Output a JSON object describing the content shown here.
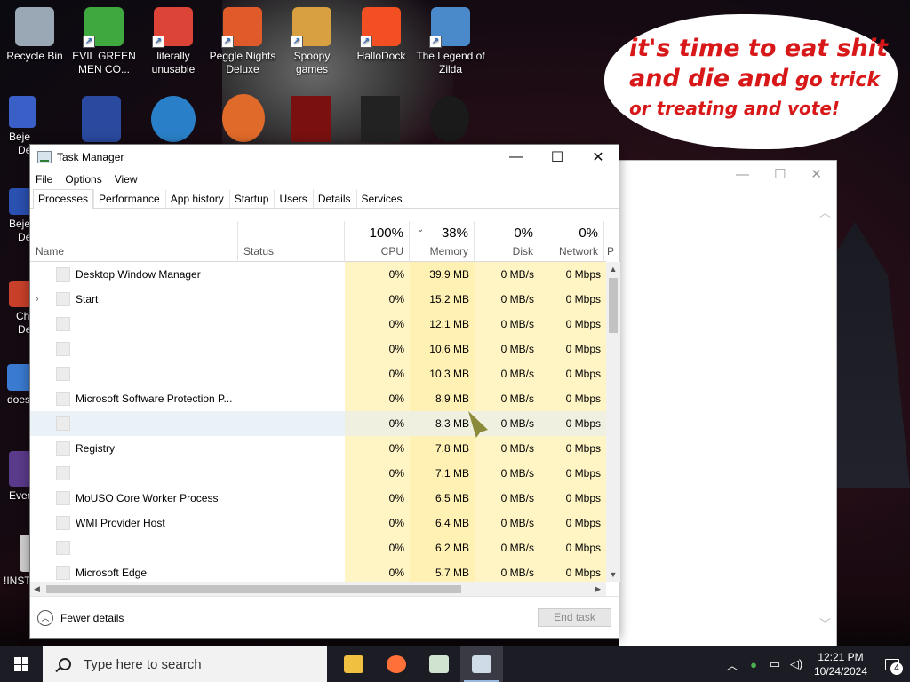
{
  "desktop": {
    "icons": [
      {
        "label": "Recycle Bin",
        "icon": "recycle-bin-icon",
        "color": "#9aa7b4"
      },
      {
        "label": "EVIL GREEN MEN CO...",
        "icon": "green-men-icon",
        "color": "#3fa83f"
      },
      {
        "label": "literally unusable",
        "icon": "chrome-icon",
        "color": "#db4437"
      },
      {
        "label": "Peggle Nights Deluxe",
        "icon": "peggle-icon",
        "color": "#e05a2a"
      },
      {
        "label": "Spoopy games",
        "icon": "folder-icon",
        "color": "#d8a040"
      },
      {
        "label": "HalloDock",
        "icon": "windows-logo-icon",
        "color": "#f25022"
      },
      {
        "label": "The Legend of Zilda",
        "icon": "zilda-icon",
        "color": "#4a8acb"
      }
    ],
    "partial_labels": [
      "Beje",
      "De",
      "Beje",
      "De",
      "Ch",
      "De",
      "does",
      "Ever",
      "!INST"
    ],
    "speech_bubble": {
      "line1": "it's time to eat shit",
      "line2a": "and die and",
      "line2b": " go trick",
      "line3": "or treating and vote!"
    }
  },
  "task_manager": {
    "title": "Task Manager",
    "menu": [
      "File",
      "Options",
      "View"
    ],
    "tabs": [
      "Processes",
      "Performance",
      "App history",
      "Startup",
      "Users",
      "Details",
      "Services"
    ],
    "active_tab": "Processes",
    "columns": {
      "name": "Name",
      "status": "Status",
      "cpu": {
        "pct": "100%",
        "label": "CPU"
      },
      "memory": {
        "pct": "38%",
        "label": "Memory"
      },
      "disk": {
        "pct": "0%",
        "label": "Disk"
      },
      "network": {
        "pct": "0%",
        "label": "Network"
      },
      "power": "P"
    },
    "processes": [
      {
        "name": "Desktop Window Manager",
        "expand": false,
        "cpu": "0%",
        "memory": "39.9 MB",
        "disk": "0 MB/s",
        "network": "0 Mbps"
      },
      {
        "name": "Start",
        "expand": true,
        "cpu": "0%",
        "memory": "15.2 MB",
        "disk": "0 MB/s",
        "network": "0 Mbps"
      },
      {
        "name": "",
        "expand": false,
        "cpu": "0%",
        "memory": "12.1 MB",
        "disk": "0 MB/s",
        "network": "0 Mbps"
      },
      {
        "name": "",
        "expand": false,
        "cpu": "0%",
        "memory": "10.6 MB",
        "disk": "0 MB/s",
        "network": "0 Mbps"
      },
      {
        "name": "",
        "expand": false,
        "cpu": "0%",
        "memory": "10.3 MB",
        "disk": "0 MB/s",
        "network": "0 Mbps"
      },
      {
        "name": "Microsoft Software Protection P...",
        "expand": false,
        "cpu": "0%",
        "memory": "8.9 MB",
        "disk": "0 MB/s",
        "network": "0 Mbps"
      },
      {
        "name": "",
        "expand": false,
        "cpu": "0%",
        "memory": "8.3 MB",
        "disk": "0 MB/s",
        "network": "0 Mbps"
      },
      {
        "name": "Registry",
        "expand": false,
        "cpu": "0%",
        "memory": "7.8 MB",
        "disk": "0 MB/s",
        "network": "0 Mbps"
      },
      {
        "name": "",
        "expand": false,
        "cpu": "0%",
        "memory": "7.1 MB",
        "disk": "0 MB/s",
        "network": "0 Mbps"
      },
      {
        "name": "MoUSO Core Worker Process",
        "expand": false,
        "cpu": "0%",
        "memory": "6.5 MB",
        "disk": "0 MB/s",
        "network": "0 Mbps"
      },
      {
        "name": "WMI Provider Host",
        "expand": false,
        "cpu": "0%",
        "memory": "6.4 MB",
        "disk": "0 MB/s",
        "network": "0 Mbps"
      },
      {
        "name": "",
        "expand": false,
        "cpu": "0%",
        "memory": "6.2 MB",
        "disk": "0 MB/s",
        "network": "0 Mbps"
      },
      {
        "name": "Microsoft Edge",
        "expand": false,
        "cpu": "0%",
        "memory": "5.7 MB",
        "disk": "0 MB/s",
        "network": "0 Mbps"
      }
    ],
    "selected_row": 6,
    "footer": {
      "fewer_details": "Fewer details",
      "end_task": "End task"
    }
  },
  "taskbar": {
    "search_placeholder": "Type here to search",
    "apps": [
      {
        "icon": "file-explorer-icon",
        "color": "#f0c040",
        "active": false
      },
      {
        "icon": "firefox-icon",
        "color": "#ff7139",
        "active": false
      },
      {
        "icon": "spreadsheet-icon",
        "color": "#cfe3d0",
        "active": false
      },
      {
        "icon": "task-manager-icon",
        "color": "#cfdbe6",
        "active": true
      }
    ],
    "time": "12:21 PM",
    "date": "10/24/2024",
    "notification_count": "4"
  },
  "colors": {
    "bubble_text": "#d81818",
    "cpu_highlight": "#fff4c4",
    "memory_highlight": "#fff0b3",
    "selected_row": "#eaf1f7",
    "taskbar": "#1c1c24"
  }
}
